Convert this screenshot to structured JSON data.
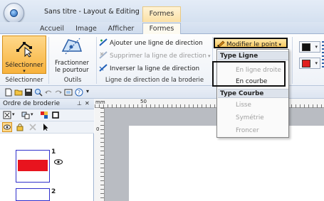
{
  "title_bar": {
    "document_title": "Sans titre - Layout & Editing",
    "context_group": "Formes"
  },
  "tabs": [
    {
      "label": "Accueil",
      "active": false
    },
    {
      "label": "Image",
      "active": false
    },
    {
      "label": "Afficher",
      "active": false
    },
    {
      "label": "Formes",
      "active": true
    }
  ],
  "ribbon": {
    "select_group": {
      "button_label": "Sélectionner",
      "group_label": "Sélectionner"
    },
    "tools_group": {
      "button_label_line1": "Fractionner",
      "button_label_line2": "le pourtour",
      "group_label": "Outils"
    },
    "direction_group": {
      "add_label": "Ajouter une ligne de direction",
      "delete_label": "Supprimer la ligne de direction",
      "invert_label": "Inverser la ligne de direction",
      "group_label": "Ligne de direction de la broderie"
    },
    "modify_point_label": "Modifier le point",
    "partial_text": "t",
    "colors": {
      "line_color": "#111111",
      "fill_color": "#e02020"
    }
  },
  "dropdown": {
    "line_type_header": "Type Ligne",
    "line_items": [
      {
        "label": "En ligne droite",
        "enabled": false
      },
      {
        "label": "En courbe",
        "enabled": true
      }
    ],
    "curve_type_header": "Type Courbe",
    "curve_items": [
      {
        "label": "Lisse",
        "enabled": false
      },
      {
        "label": "Symétrie",
        "enabled": false
      },
      {
        "label": "Froncer",
        "enabled": false
      }
    ]
  },
  "panel": {
    "title": "Ordre de broderie",
    "pin_glyph": "⊥",
    "close_glyph": "✕",
    "items": [
      {
        "number": "1",
        "swatch_color": "#e8141e"
      },
      {
        "number": "2",
        "swatch_color": "#ffffff"
      }
    ]
  },
  "ruler": {
    "corner_label": "mm",
    "top_tick_label": "50",
    "left_tick_label": "0"
  }
}
